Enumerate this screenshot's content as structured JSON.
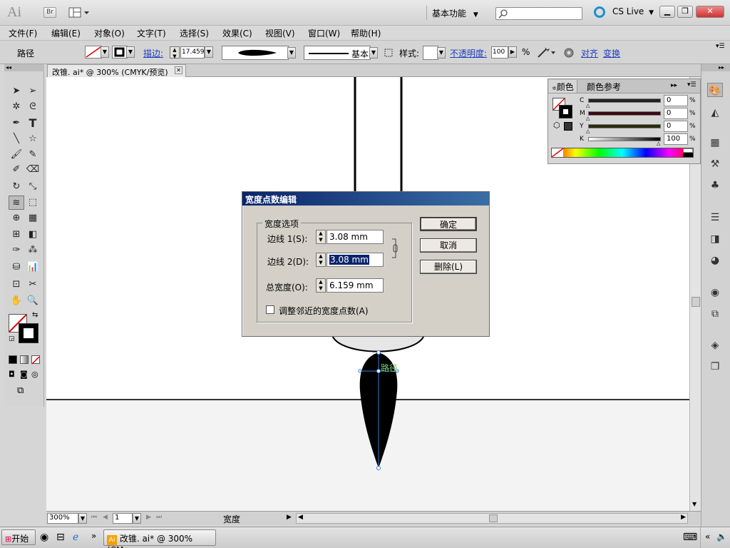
{
  "app": {
    "logo": "Ai",
    "bridge_label": "Br",
    "workspace": "基本功能",
    "cslive": "CS Live"
  },
  "menu": [
    "文件(F)",
    "编辑(E)",
    "对象(O)",
    "文字(T)",
    "选择(S)",
    "效果(C)",
    "视图(V)",
    "窗口(W)",
    "帮助(H)"
  ],
  "control": {
    "object_type": "路径",
    "stroke_label": "描边:",
    "stroke_value": "17.459",
    "profile_label": "基本",
    "style_label": "样式:",
    "opacity_label": "不透明度:",
    "opacity_value": "100",
    "percent": "%",
    "align_label": "对齐",
    "transform_label": "变换"
  },
  "document": {
    "tab_title": "改锥. ai* @ 300% (CMYK/预览)"
  },
  "color_panel": {
    "tab_color": "颜色",
    "tab_guide": "颜色参考",
    "channels": [
      {
        "label": "C",
        "value": "0"
      },
      {
        "label": "M",
        "value": "0"
      },
      {
        "label": "Y",
        "value": "0"
      },
      {
        "label": "K",
        "value": "100"
      }
    ],
    "percent": "%"
  },
  "canvas": {
    "path_label": "路径"
  },
  "dialog": {
    "title": "宽度点数编辑",
    "group_label": "宽度选项",
    "side1_label": "边线 1(S):",
    "side1_value": "3.08 mm",
    "side2_label": "边线 2(D):",
    "side2_value": "3.08 mm",
    "total_label": "总宽度(O):",
    "total_value": "6.159 mm",
    "adjust_label": "调整邻近的宽度点数(A)",
    "ok": "确定",
    "cancel": "取消",
    "delete": "删除(L)"
  },
  "status": {
    "zoom": "300%",
    "page": "1",
    "tool_name": "宽度"
  },
  "taskbar": {
    "start": "开始",
    "task": "改锥. ai* @ 300% (CM..."
  }
}
